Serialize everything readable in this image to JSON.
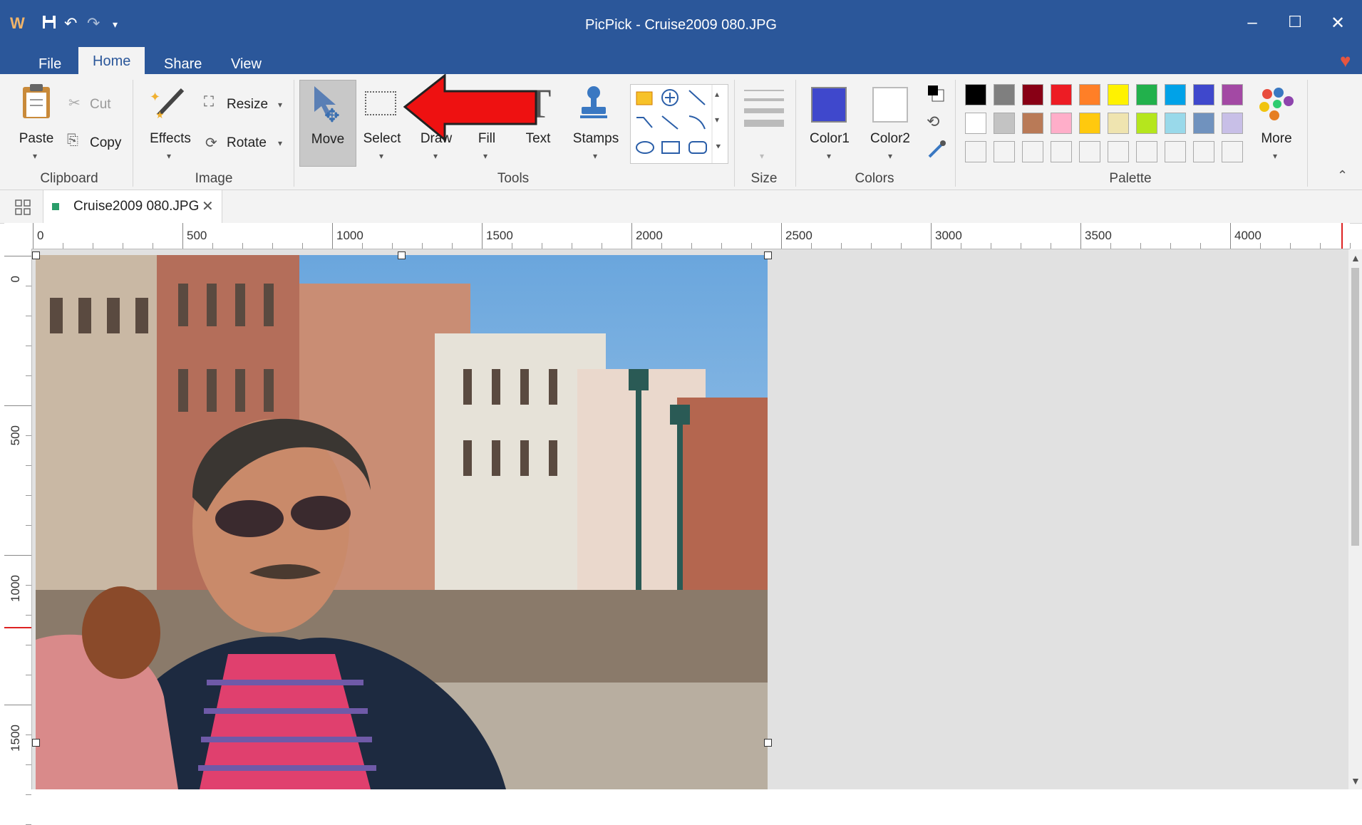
{
  "window": {
    "title": "PicPick - Cruise2009 080.JPG"
  },
  "menu_tabs": [
    "File",
    "Home",
    "Share",
    "View"
  ],
  "ribbon": {
    "clipboard": {
      "paste": "Paste",
      "cut": "Cut",
      "copy": "Copy",
      "group": "Clipboard"
    },
    "image": {
      "effects": "Effects",
      "resize": "Resize",
      "rotate": "Rotate",
      "group": "Image"
    },
    "tools": {
      "move": "Move",
      "select": "Select",
      "draw": "Draw",
      "fill": "Fill",
      "text": "Text",
      "stamps": "Stamps",
      "group": "Tools"
    },
    "size": {
      "group": "Size"
    },
    "colors": {
      "color1": "Color1",
      "color2": "Color2",
      "group": "Colors"
    },
    "palette": {
      "more": "More",
      "group": "Palette",
      "row1": [
        "#000000",
        "#7f7f7f",
        "#880015",
        "#ed1c24",
        "#ff7f27",
        "#fff200",
        "#22b14c",
        "#00a2e8",
        "#3f48cc",
        "#a349a4"
      ],
      "row2": [
        "#ffffff",
        "#c3c3c3",
        "#b97a57",
        "#ffaec9",
        "#ffc90e",
        "#efe4b0",
        "#b5e61d",
        "#99d9ea",
        "#7092be",
        "#c8bfe7"
      ]
    }
  },
  "colors": {
    "color1": "#3f48cc",
    "color2": "#ffffff",
    "titlebar": "#2b579a",
    "arrow": "#ee1111"
  },
  "document_tab": {
    "name": "Cruise2009 080.JPG"
  },
  "ruler": {
    "h_ticks": [
      "0",
      "500",
      "1000",
      "1500",
      "2000",
      "2500",
      "3000",
      "3500",
      "4000"
    ],
    "v_ticks": [
      "0",
      "500",
      "1000",
      "1500"
    ]
  }
}
